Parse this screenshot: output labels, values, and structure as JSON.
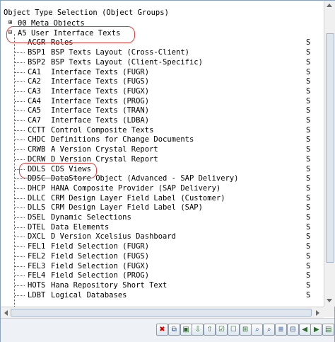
{
  "tree": {
    "root_label": "Object Type Selection (Object Groups)",
    "groups": [
      {
        "expander": "⊞",
        "label": "00 Meta Objects"
      },
      {
        "expander": "⊟",
        "label": "A5 User Interface Texts"
      }
    ],
    "items": [
      {
        "code": "ACGR",
        "text": "Roles",
        "s": "S"
      },
      {
        "code": "BSP1",
        "text": "BSP Texts Layout (Cross-Client)",
        "s": "S"
      },
      {
        "code": "BSP2",
        "text": "BSP Texts Layout (Client-Specific)",
        "s": "S"
      },
      {
        "code": "CA1",
        "text": "Interface Texts (FUGR)",
        "s": "S"
      },
      {
        "code": "CA2",
        "text": "Interface Texts (FUGS)",
        "s": "S"
      },
      {
        "code": "CA3",
        "text": "Interface Texts (FUGX)",
        "s": "S"
      },
      {
        "code": "CA4",
        "text": "Interface Texts (PROG)",
        "s": "S"
      },
      {
        "code": "CA5",
        "text": "Interface Texts (TRAN)",
        "s": "S"
      },
      {
        "code": "CA7",
        "text": "Interface Texts (LDBA)",
        "s": "S"
      },
      {
        "code": "CCTT",
        "text": "Control Composite Texts",
        "s": "S"
      },
      {
        "code": "CHDC",
        "text": "Definitions for Change Documents",
        "s": "S"
      },
      {
        "code": "CRWB",
        "text": "A Version Crystal Report",
        "s": "S"
      },
      {
        "code": "DCRW",
        "text": "D Version Crystal Report",
        "s": "S"
      },
      {
        "code": "DDLS",
        "text": "CDS Views",
        "s": "S"
      },
      {
        "code": "DDSC",
        "text": "DataStore Object (Advanced - SAP Delivery)",
        "s": "S"
      },
      {
        "code": "DHCP",
        "text": "HANA Composite Provider (SAP Delivery)",
        "s": "S"
      },
      {
        "code": "DLLC",
        "text": "CRM Design Layer Field Label (Customer)",
        "s": "S"
      },
      {
        "code": "DLLS",
        "text": "CRM Design Layer Field Label (SAP)",
        "s": "S"
      },
      {
        "code": "DSEL",
        "text": "Dynamic Selections",
        "s": "S"
      },
      {
        "code": "DTEL",
        "text": "Data Elements",
        "s": "S"
      },
      {
        "code": "DXCL",
        "text": "D Version Xcelsius Dashboard",
        "s": "S"
      },
      {
        "code": "FEL1",
        "text": "Field Selection (FUGR)",
        "s": "S"
      },
      {
        "code": "FEL2",
        "text": "Field Selection (FUGS)",
        "s": "S"
      },
      {
        "code": "FEL3",
        "text": "Field Selection (FUGX)",
        "s": "S"
      },
      {
        "code": "FEL4",
        "text": "Field Selection (PROG)",
        "s": "S"
      },
      {
        "code": "HOTS",
        "text": "Hana Repository Short Text",
        "s": "S"
      },
      {
        "code": "LDBT",
        "text": "Logical Databases",
        "s": "S"
      }
    ]
  },
  "toolbar": {
    "buttons": [
      {
        "name": "cancel-icon",
        "glyph": "✖",
        "style": "red"
      },
      {
        "name": "copy-icon",
        "glyph": "⧉",
        "style": "blue"
      },
      {
        "name": "select-block-icon",
        "glyph": "▣",
        "style": "green"
      },
      {
        "name": "expand-subtree-icon",
        "glyph": "⇩",
        "style": "green"
      },
      {
        "name": "collapse-subtree-icon",
        "glyph": "⇧",
        "style": "green"
      },
      {
        "name": "select-all-icon",
        "glyph": "☑",
        "style": "green"
      },
      {
        "name": "deselect-all-icon",
        "glyph": "☐",
        "style": "green"
      },
      {
        "name": "tree-structure-icon",
        "glyph": "⊞",
        "style": "green"
      },
      {
        "name": "find-icon",
        "glyph": "⌕",
        "style": "blue"
      },
      {
        "name": "find-next-icon",
        "glyph": "⌕",
        "style": "blue"
      },
      {
        "name": "filter-icon",
        "glyph": "≣",
        "style": "blue"
      },
      {
        "name": "save-variant-icon",
        "glyph": "⊟",
        "style": "blue"
      },
      {
        "name": "previous-icon",
        "glyph": "◀",
        "style": "green"
      },
      {
        "name": "next-icon",
        "glyph": "▶",
        "style": "green"
      },
      {
        "name": "page-icon",
        "glyph": "▤",
        "style": "green"
      }
    ]
  }
}
